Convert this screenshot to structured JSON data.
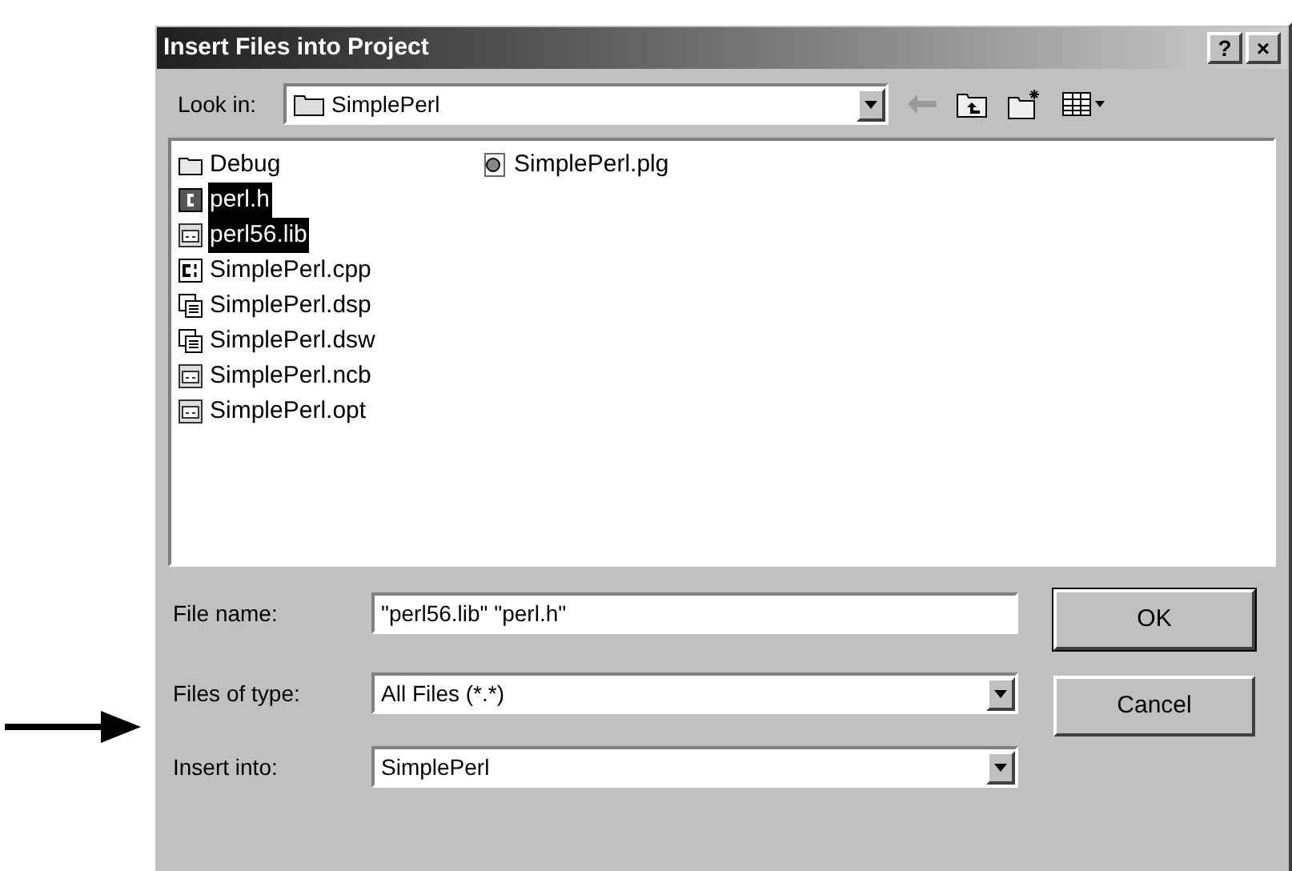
{
  "window": {
    "title": "Insert Files into Project",
    "title_buttons": [
      "?",
      "×"
    ]
  },
  "look_in": {
    "label": "Look in:",
    "value": "SimplePerl"
  },
  "files": [
    {
      "name": "Debug",
      "kind": "folder",
      "selected": false
    },
    {
      "name": "perl.h",
      "kind": "header",
      "selected": true
    },
    {
      "name": "perl56.lib",
      "kind": "binary",
      "selected": true
    },
    {
      "name": "SimplePerl.cpp",
      "kind": "source",
      "selected": false
    },
    {
      "name": "SimplePerl.dsp",
      "kind": "project",
      "selected": false
    },
    {
      "name": "SimplePerl.dsw",
      "kind": "project",
      "selected": false
    },
    {
      "name": "SimplePerl.ncb",
      "kind": "binary",
      "selected": false
    },
    {
      "name": "SimplePerl.opt",
      "kind": "binary",
      "selected": false
    },
    {
      "name": "SimplePerl.plg",
      "kind": "web",
      "selected": false
    }
  ],
  "file_name": {
    "label": "File name:",
    "value": "\"perl56.lib\" \"perl.h\""
  },
  "files_of_type": {
    "label": "Files of type:",
    "value": "All Files (*.*)"
  },
  "insert_into": {
    "label": "Insert into:",
    "value": "SimplePerl"
  },
  "buttons": [
    "OK",
    "Cancel"
  ]
}
